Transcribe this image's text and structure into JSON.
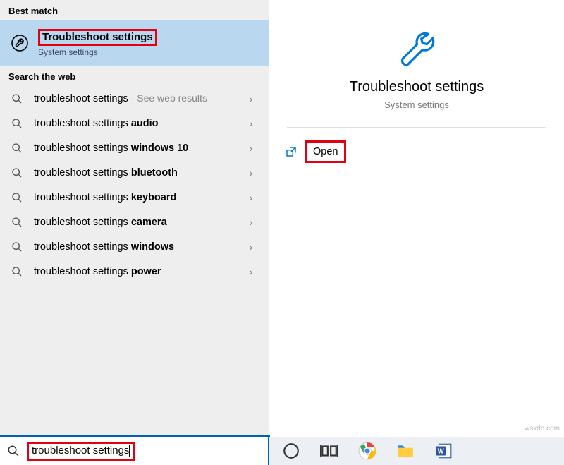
{
  "sections": {
    "best_match_header": "Best match",
    "web_header": "Search the web"
  },
  "best_match": {
    "title": "Troubleshoot settings",
    "subtitle": "System settings"
  },
  "web_results": [
    {
      "prefix": "troubleshoot settings",
      "bold": "",
      "suffix": " - See web results"
    },
    {
      "prefix": "troubleshoot settings ",
      "bold": "audio",
      "suffix": ""
    },
    {
      "prefix": "troubleshoot settings ",
      "bold": "windows 10",
      "suffix": ""
    },
    {
      "prefix": "troubleshoot settings ",
      "bold": "bluetooth",
      "suffix": ""
    },
    {
      "prefix": "troubleshoot settings ",
      "bold": "keyboard",
      "suffix": ""
    },
    {
      "prefix": "troubleshoot settings ",
      "bold": "camera",
      "suffix": ""
    },
    {
      "prefix": "troubleshoot settings ",
      "bold": "windows",
      "suffix": ""
    },
    {
      "prefix": "troubleshoot settings ",
      "bold": "power",
      "suffix": ""
    }
  ],
  "preview": {
    "title": "Troubleshoot settings",
    "subtitle": "System settings",
    "open_label": "Open"
  },
  "search": {
    "query": "troubleshoot settings"
  },
  "watermark": "wsxdn.com"
}
